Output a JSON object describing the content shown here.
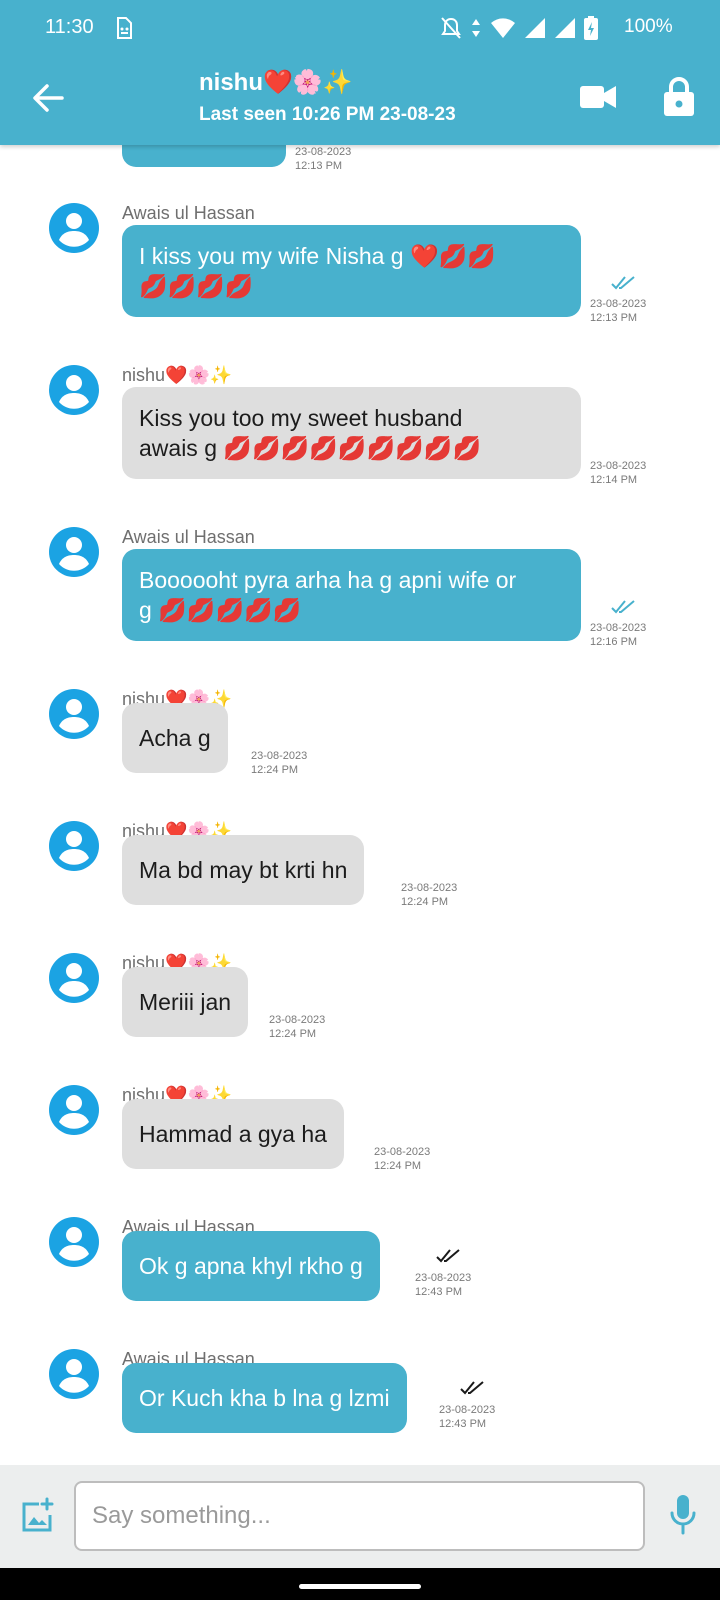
{
  "status_bar": {
    "time": "11:30",
    "battery": "100%"
  },
  "header": {
    "back_icon": "arrow-left-icon",
    "title": "nishu❤️🌸✨",
    "subtitle": "Last seen 10:26 PM 23-08-23",
    "video_icon": "video-camera-icon",
    "lock_icon": "lock-icon"
  },
  "partial_top": {
    "date": "23-08-2023",
    "time": "12:13 PM"
  },
  "messages": [
    {
      "sender": "Awais ul Hassan",
      "direction": "out",
      "text": "I kiss you my wife Nisha g ❤️💋💋\n💋💋💋💋",
      "date": "23-08-2023",
      "time": "12:13 PM",
      "ticks": "read"
    },
    {
      "sender": "nishu❤️🌸✨",
      "direction": "in",
      "text": "Kiss you too my sweet husband\nawais g 💋💋💋💋💋💋💋💋💋",
      "date": "23-08-2023",
      "time": "12:14 PM"
    },
    {
      "sender": "Awais ul Hassan",
      "direction": "out",
      "text": "Boooooht pyra arha ha g apni wife or\ng 💋💋💋💋💋",
      "date": "23-08-2023",
      "time": "12:16 PM",
      "ticks": "read"
    },
    {
      "sender": "nishu❤️🌸✨",
      "direction": "in",
      "text": "Acha g",
      "date": "23-08-2023",
      "time": "12:24 PM"
    },
    {
      "sender": "nishu❤️🌸✨",
      "direction": "in",
      "text": "Ma bd may bt krti hn",
      "date": "23-08-2023",
      "time": "12:24 PM"
    },
    {
      "sender": "nishu❤️🌸✨",
      "direction": "in",
      "text": "Meriii jan",
      "date": "23-08-2023",
      "time": "12:24 PM"
    },
    {
      "sender": "nishu❤️🌸✨",
      "direction": "in",
      "text": "Hammad a gya ha",
      "date": "23-08-2023",
      "time": "12:24 PM"
    },
    {
      "sender": "Awais ul Hassan",
      "direction": "out",
      "text": "Ok g apna khyl rkho g",
      "date": "23-08-2023",
      "time": "12:43 PM",
      "ticks": "delivered"
    },
    {
      "sender": "Awais ul Hassan",
      "direction": "out",
      "text": "Or Kuch kha b lna g lzmi",
      "date": "23-08-2023",
      "time": "12:43 PM",
      "ticks": "delivered"
    }
  ],
  "composer": {
    "placeholder": "Say something...",
    "attach_icon": "add-image-icon",
    "mic_icon": "microphone-icon"
  },
  "colors": {
    "accent": "#48b1cd",
    "incoming_bubble": "#dedede",
    "read_tick": "#48b1cd",
    "avatar": "#1ba3e3"
  }
}
